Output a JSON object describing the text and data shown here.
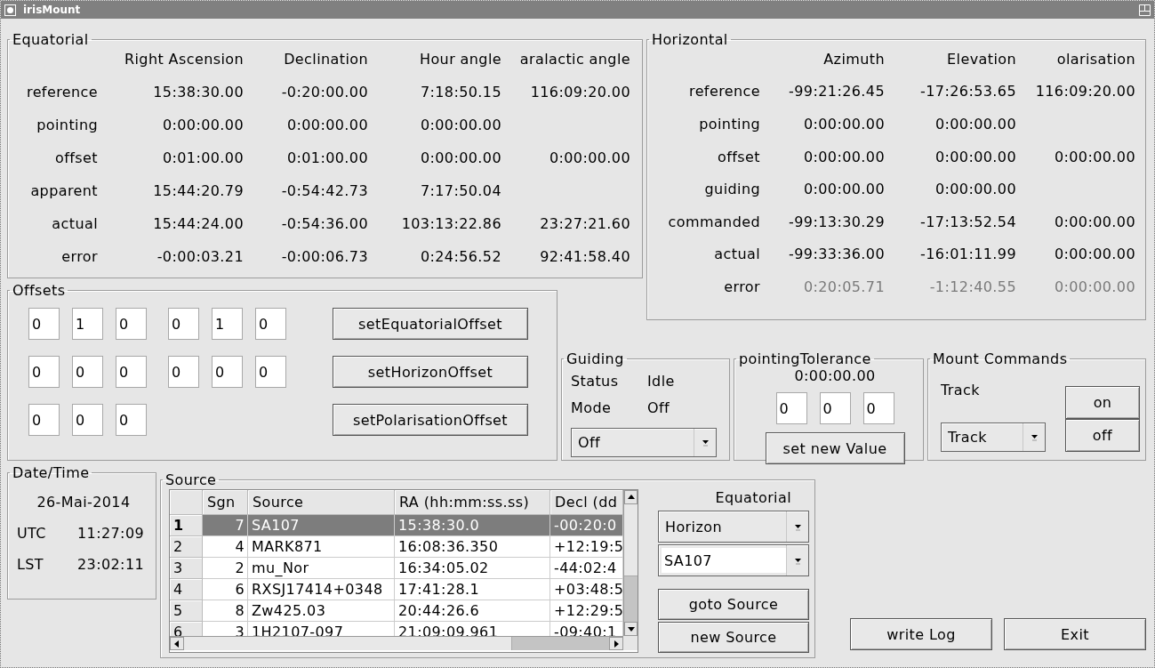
{
  "window": {
    "title": "irisMount"
  },
  "equatorial": {
    "title": "Equatorial",
    "columns": [
      "Right Ascension",
      "Declination",
      "Hour angle",
      "aralactic angle"
    ],
    "rows": [
      {
        "label": "reference",
        "values": [
          "15:38:30.00",
          "-0:20:00.00",
          "7:18:50.15",
          "116:09:20.00"
        ]
      },
      {
        "label": "pointing",
        "values": [
          "0:00:00.00",
          "0:00:00.00",
          "0:00:00.00"
        ]
      },
      {
        "label": "offset",
        "values": [
          "0:01:00.00",
          "0:01:00.00",
          "0:00:00.00",
          "0:00:00.00"
        ]
      },
      {
        "label": "apparent",
        "values": [
          "15:44:20.79",
          "-0:54:42.73",
          "7:17:50.04"
        ]
      },
      {
        "label": "actual",
        "values": [
          "15:44:24.00",
          "-0:54:36.00",
          "103:13:22.86",
          "23:27:21.60"
        ]
      },
      {
        "label": "error",
        "values": [
          "-0:00:03.21",
          "-0:00:06.73",
          "0:24:56.52",
          "92:41:58.40"
        ]
      }
    ]
  },
  "horizontal": {
    "title": "Horizontal",
    "columns": [
      "Azimuth",
      "Elevation",
      "olarisation"
    ],
    "rows": [
      {
        "label": "reference",
        "values": [
          "-99:21:26.45",
          "-17:26:53.65",
          "116:09:20.00"
        ],
        "disabled": false
      },
      {
        "label": "pointing",
        "values": [
          "0:00:00.00",
          "0:00:00.00"
        ],
        "disabled": false
      },
      {
        "label": "offset",
        "values": [
          "0:00:00.00",
          "0:00:00.00",
          "0:00:00.00"
        ],
        "disabled": false
      },
      {
        "label": "guiding",
        "values": [
          "0:00:00.00",
          "0:00:00.00"
        ],
        "disabled": false
      },
      {
        "label": "commanded",
        "values": [
          "-99:13:30.29",
          "-17:13:52.54",
          "0:00:00.00"
        ],
        "disabled": false
      },
      {
        "label": "actual",
        "values": [
          "-99:33:36.00",
          "-16:01:11.99",
          "0:00:00.00"
        ],
        "disabled": false
      },
      {
        "label": "error",
        "values": [
          "0:20:05.71",
          "-1:12:40.55",
          "0:00:00.00"
        ],
        "disabled": true
      }
    ]
  },
  "offsets": {
    "title": "Offsets",
    "rows": [
      {
        "fields": [
          "0",
          "1",
          "0",
          "0",
          "1",
          "0"
        ],
        "button": "setEquatorialOffset"
      },
      {
        "fields": [
          "0",
          "0",
          "0",
          "0",
          "0",
          "0"
        ],
        "button": "setHorizonOffset"
      },
      {
        "fields": [
          "0",
          "0",
          "0"
        ],
        "button": "setPolarisationOffset"
      }
    ]
  },
  "guiding": {
    "title": "Guiding",
    "status_label": "Status",
    "status": "Idle",
    "mode_label": "Mode",
    "mode": "Off",
    "mode_select": "Off"
  },
  "pointing_tolerance": {
    "title": "pointingTolerance",
    "value": "0:00:00.00",
    "fields": [
      "0",
      "0",
      "0"
    ],
    "button": "set new Value"
  },
  "mount_commands": {
    "title": "Mount Commands",
    "track_label": "Track",
    "track_select": "Track",
    "buttons": [
      "on",
      "off"
    ]
  },
  "date_time": {
    "title": "Date/Time",
    "date": "26-Mai-2014",
    "rows": [
      {
        "label": "UTC",
        "value": "11:27:09"
      },
      {
        "label": "LST",
        "value": "23:02:11"
      }
    ]
  },
  "source": {
    "title": "Source",
    "table": {
      "columns": [
        "Sgn",
        "Source",
        "RA (hh:mm:ss.ss)",
        "Decl (dd"
      ],
      "rows": [
        {
          "number": "1",
          "cells": [
            "7",
            "SA107",
            "15:38:30.0",
            "-00:20:0"
          ],
          "selected": true
        },
        {
          "number": "2",
          "cells": [
            "4",
            "MARK871",
            "16:08:36.350",
            "+12:19:5"
          ],
          "selected": false
        },
        {
          "number": "3",
          "cells": [
            "2",
            "mu_Nor",
            "16:34:05.02",
            "-44:02:4"
          ],
          "selected": false
        },
        {
          "number": "4",
          "cells": [
            "6",
            "RXSJ17414+0348",
            "17:41:28.1",
            "+03:48:5"
          ],
          "selected": false
        },
        {
          "number": "5",
          "cells": [
            "8",
            "Zw425.03",
            "20:44:26.6",
            "+12:29:5"
          ],
          "selected": false
        },
        {
          "number": "6",
          "cells": [
            "3",
            "1H2107-097",
            "21:09:09.961",
            "-09:40:1"
          ],
          "selected": false
        }
      ]
    },
    "frame_label": "Equatorial",
    "frame_select": "Horizon",
    "source_select": "SA107",
    "buttons": [
      "goto Source",
      "new Source"
    ]
  },
  "buttons": [
    "write Log",
    "Exit"
  ]
}
